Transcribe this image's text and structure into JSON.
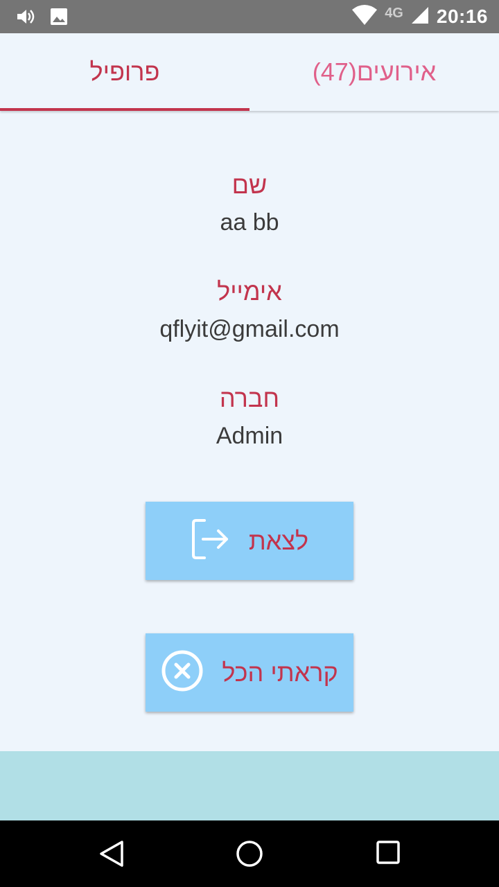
{
  "status_bar": {
    "time": "20:16",
    "network": "4G",
    "icons": [
      "volume-icon",
      "image-icon",
      "wifi-icon",
      "signal-icon"
    ]
  },
  "tabs": [
    {
      "label": "פרופיל",
      "active": true
    },
    {
      "label": "(47)אירועים",
      "active": false
    }
  ],
  "profile": {
    "name_label": "שם",
    "name_value": "aa bb",
    "email_label": "אימייל",
    "email_value": "qflyit@gmail.com",
    "company_label": "חברה",
    "company_value": "Admin"
  },
  "buttons": {
    "logout_label": "לצאת",
    "logout_icon": "logout-icon",
    "mark_all_read_label": "קראתי הכל",
    "mark_all_read_icon": "close-circle-icon"
  },
  "nav_bar": {
    "icons": [
      "back-icon",
      "home-icon",
      "recents-icon"
    ]
  },
  "colors": {
    "accent": "#c2344d",
    "inactive_tab": "#e0608a",
    "button_bg": "#8ecff9",
    "background": "#eef5fc",
    "bottom_band": "#b1dfe6"
  }
}
